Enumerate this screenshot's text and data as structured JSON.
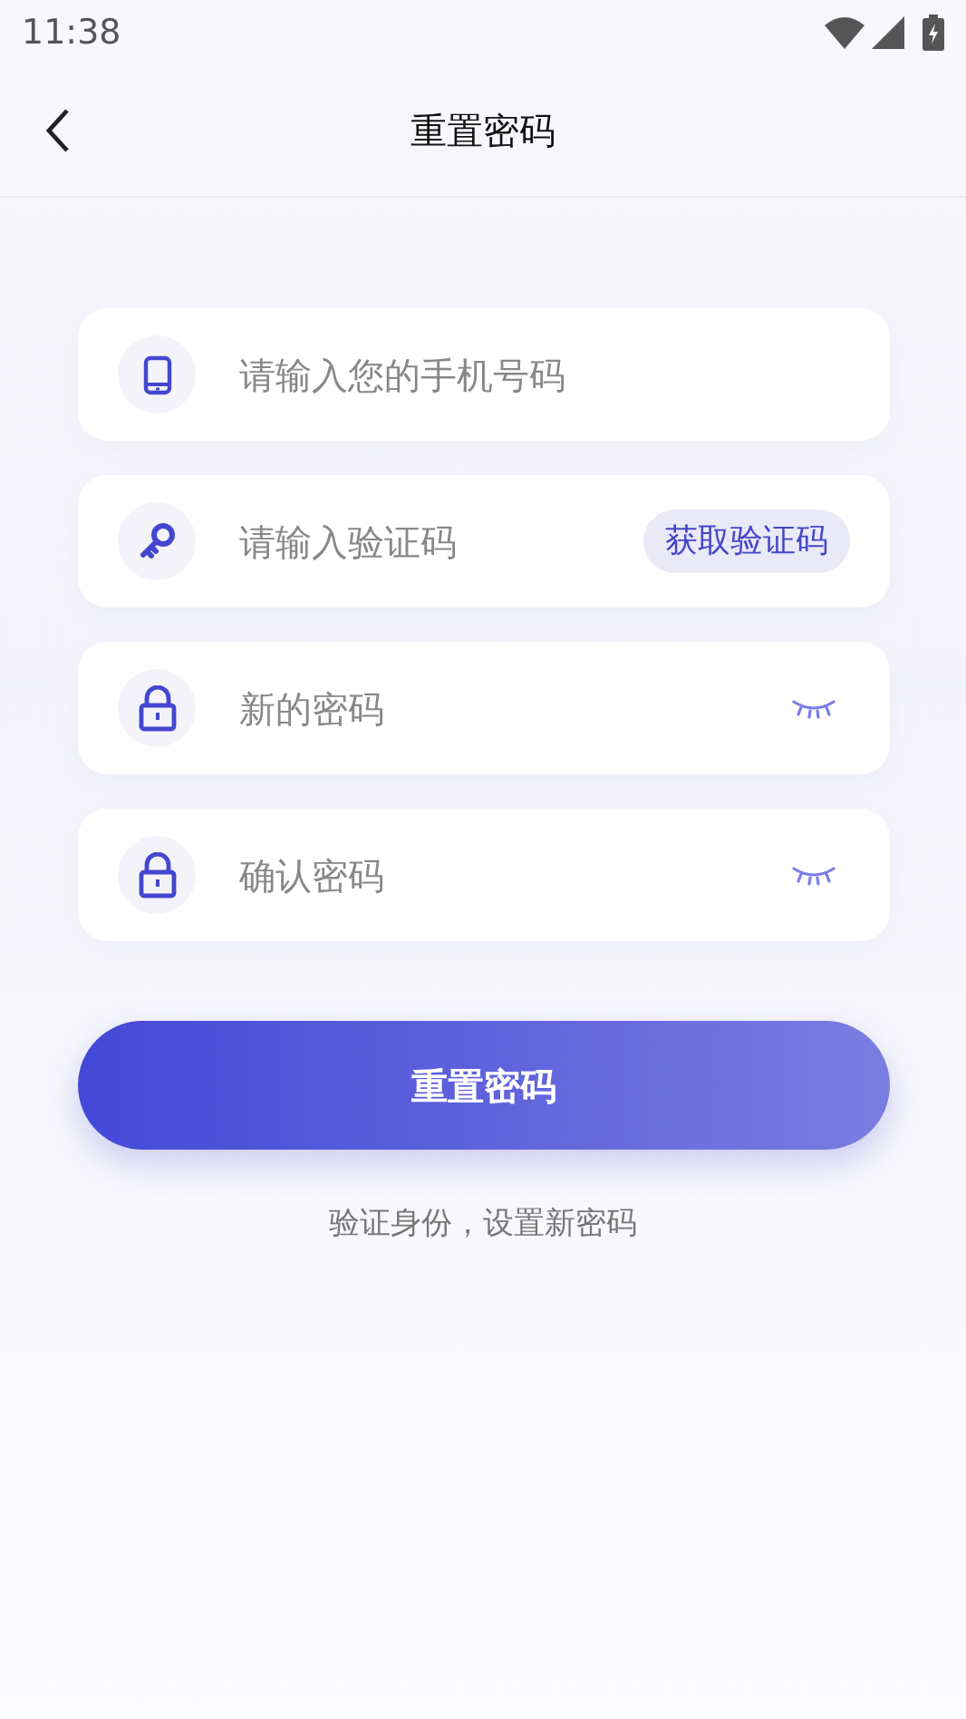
{
  "status_bar": {
    "time": "11:38"
  },
  "header": {
    "title": "重置密码"
  },
  "fields": [
    {
      "kind": "phone",
      "placeholder": "请输入您的手机号码"
    },
    {
      "kind": "code",
      "placeholder": "请输入验证码",
      "action": "获取验证码"
    },
    {
      "kind": "password",
      "placeholder": "新的密码",
      "visible": false
    },
    {
      "kind": "password",
      "placeholder": "确认密码",
      "visible": false
    }
  ],
  "submit": "重置密码",
  "caption": "验证身份，设置新密码"
}
